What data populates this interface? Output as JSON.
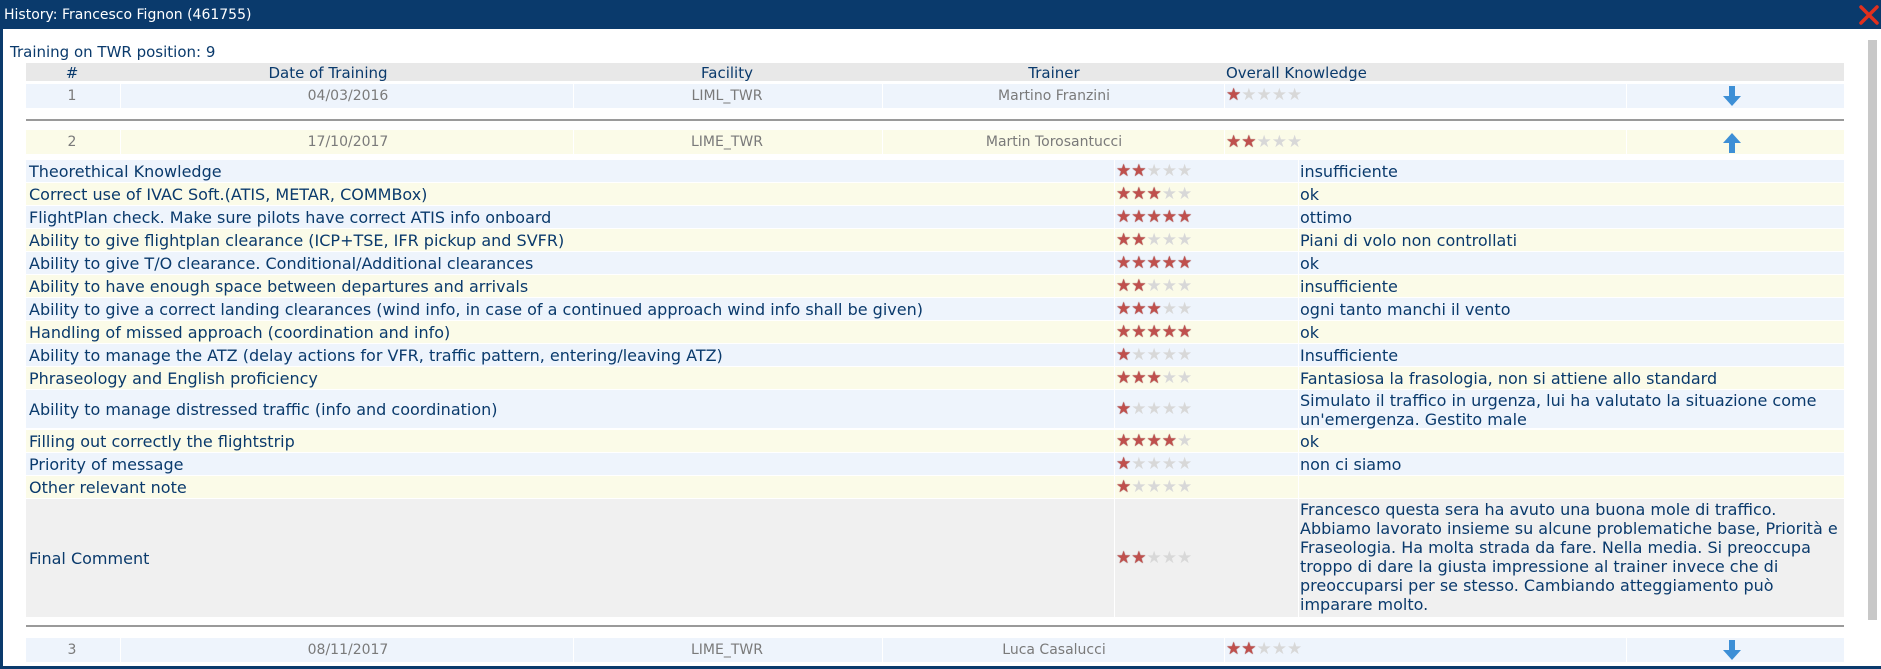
{
  "window": {
    "title": "History: Francesco Fignon (461755)",
    "close_icon": "close-x-icon",
    "accent": "#0a3a6c"
  },
  "subtitle": "Training on TWR position: 9",
  "columns": {
    "num": "#",
    "date": "Date of Training",
    "facility": "Facility",
    "trainer": "Trainer",
    "overall": "Overall Knowledge"
  },
  "sessions": [
    {
      "num": "1",
      "date": "04/03/2016",
      "facility": "LIML_TWR",
      "trainer": "Martino Franzini",
      "overall": 1,
      "toggle": "arrow-down-icon"
    },
    {
      "num": "2",
      "date": "17/10/2017",
      "facility": "LIME_TWR",
      "trainer": "Martin Torosantucci",
      "overall": 2,
      "toggle": "arrow-up-icon"
    },
    {
      "num": "3",
      "date": "08/11/2017",
      "facility": "LIME_TWR",
      "trainer": "Luca Casalucci",
      "overall": 2,
      "toggle": "arrow-down-icon"
    }
  ],
  "details": [
    {
      "label": "Theorethical Knowledge",
      "stars": 2,
      "comment": "insufficiente"
    },
    {
      "label": "Correct use of IVAC Soft.(ATIS, METAR, COMMBox)",
      "stars": 3,
      "comment": "ok"
    },
    {
      "label": "FlightPlan check. Make sure pilots have correct ATIS info onboard",
      "stars": 5,
      "comment": "ottimo"
    },
    {
      "label": "Ability to give flightplan clearance (ICP+TSE, IFR pickup and SVFR)",
      "stars": 2,
      "comment": "Piani di volo non controllati"
    },
    {
      "label": "Ability to give T/O clearance. Conditional/Additional clearances",
      "stars": 5,
      "comment": "ok"
    },
    {
      "label": "Ability to have enough space between departures and arrivals",
      "stars": 2,
      "comment": "insufficiente"
    },
    {
      "label": "Ability to give a correct landing clearances (wind info, in case of a continued approach wind info shall be given)",
      "stars": 3,
      "comment": "ogni tanto manchi il vento"
    },
    {
      "label": "Handling of missed approach (coordination and info)",
      "stars": 5,
      "comment": "ok"
    },
    {
      "label": "Ability to manage the ATZ (delay actions for VFR, traffic pattern, entering/leaving ATZ)",
      "stars": 1,
      "comment": "Insufficiente"
    },
    {
      "label": "Phraseology and English proficiency",
      "stars": 3,
      "comment": "Fantasiosa la frasologia, non si attiene allo standard"
    },
    {
      "label": "Ability to manage distressed traffic (info and coordination)",
      "stars": 1,
      "comment": "Simulato il traffico in urgenza, lui ha valutato la situazione come un'emergenza. Gestito male"
    },
    {
      "label": "Filling out correctly the flightstrip",
      "stars": 4,
      "comment": "ok"
    },
    {
      "label": "Priority of message",
      "stars": 1,
      "comment": "non ci siamo"
    },
    {
      "label": "Other relevant note",
      "stars": 1,
      "comment": ""
    },
    {
      "label": "Final Comment",
      "stars": 2,
      "comment": "Francesco questa sera ha avuto una buona mole di traffico. Abbiamo lavorato insieme su alcune problematiche base, Priorità e Fraseologia. Ha molta strada da fare. Nella media. Si preoccupa troppo di dare la giusta impressione al trainer invece che di preoccuparsi per se stesso. Cambiando atteggiamento può imparare molto."
    }
  ],
  "colors": {
    "star_on": "#c0504d",
    "star_off": "#d8d8d8",
    "arrow": "#3d8fd6"
  }
}
